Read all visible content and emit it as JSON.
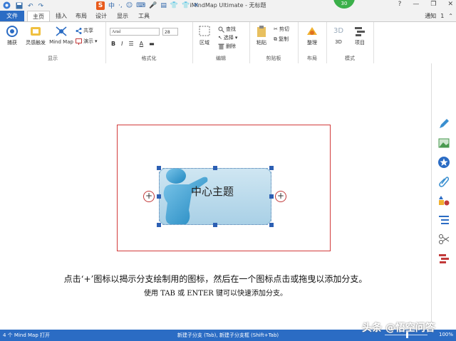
{
  "window": {
    "title": "iMindMap Ultimate - 无标题",
    "qat_icons": [
      "app-icon",
      "save-icon",
      "undo-icon",
      "redo-icon"
    ],
    "ime_logo": "S",
    "ime_items": [
      "中",
      "·,",
      "☺",
      "⌨",
      "🎤",
      "▤",
      "👕",
      "👕",
      "✕"
    ],
    "badge": "30",
    "controls": [
      "?",
      "—",
      "❐",
      "✕"
    ]
  },
  "tabs": {
    "file": "文件",
    "items": [
      "主页",
      "插入",
      "布局",
      "设计",
      "显示",
      "工具"
    ],
    "notify": "通知",
    "notify_count": "1"
  },
  "ribbon": {
    "display": {
      "label": "显示",
      "capture": "捕获",
      "inspiration": "灵感触发",
      "mindmap": "Mind Map",
      "share": "共享",
      "present": "演示"
    },
    "format": {
      "label": "格式化",
      "font": "Arial",
      "size": "28",
      "bold": "B",
      "italic": "I",
      "font_color": "A"
    },
    "edit": {
      "label": "编辑",
      "region": "区域",
      "find": "查找",
      "select": "选择",
      "delete": "删除"
    },
    "clipboard": {
      "label": "剪贴板",
      "paste": "粘贴",
      "cut": "剪切",
      "copy": "复制"
    },
    "layout": {
      "label": "布局",
      "arrange": "整理"
    },
    "mode": {
      "label": "模式",
      "three_d": "3D",
      "project": "项目",
      "three_d_icon": "3D"
    }
  },
  "canvas": {
    "central_topic": "中心主题",
    "plus": "+",
    "hint_line1": "点击‘+’图标以揭示分支绘制用的图标，然后在一个图标点击或拖曳以添加分支。",
    "hint_line2": "使用 TAB 或 ENTER 键可以快速添加分支。"
  },
  "status": {
    "left": "4 个 Mind Map 打开",
    "middle": "新建子分支 (Tab), 新建子分支框 (Shift+Tab)",
    "zoom": "100%",
    "watermark": "头条 @悟空问答"
  },
  "colors": {
    "accent": "#2b6cc4",
    "frame": "#d23b3b",
    "topic_fill": "#bcdcec",
    "figure": "#3a9fd0",
    "handle": "#2c5fb3"
  }
}
